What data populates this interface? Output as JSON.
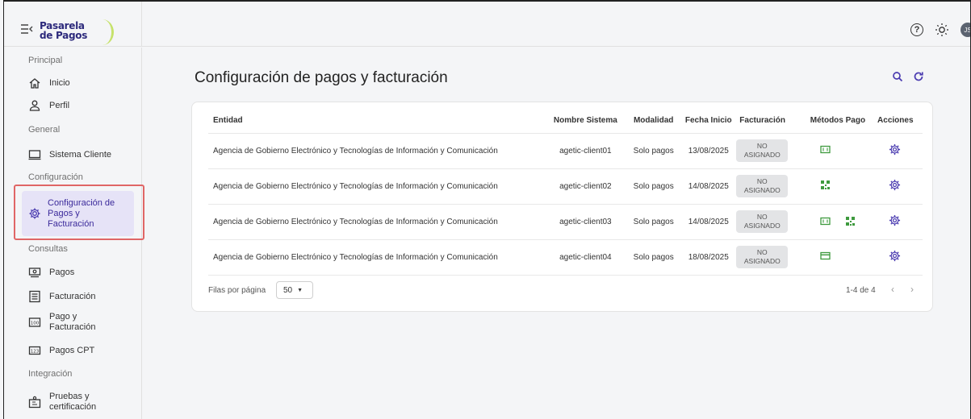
{
  "app": {
    "logo_line1": "Pasarela",
    "logo_line2": "de Pagos",
    "user_initials": "JS"
  },
  "sidebar": {
    "sections": [
      {
        "title": "Principal"
      },
      {
        "title": "General"
      },
      {
        "title": "Configuración"
      },
      {
        "title": "Consultas"
      },
      {
        "title": "Integración"
      }
    ],
    "items": [
      {
        "label": "Inicio",
        "icon": "home-icon"
      },
      {
        "label": "Perfil",
        "icon": "user-icon"
      },
      {
        "label": "Sistema Cliente",
        "icon": "monitor-icon"
      },
      {
        "label": "Configuración de Pagos y Facturación",
        "icon": "gear-icon",
        "active": true
      },
      {
        "label": "Pagos",
        "icon": "payments-icon"
      },
      {
        "label": "Facturación",
        "icon": "invoice-icon"
      },
      {
        "label_line1": "Pago y",
        "label_line2": "Facturación",
        "icon": "pay-invoice-icon"
      },
      {
        "label": "Pagos CPT",
        "icon": "cpt-icon"
      },
      {
        "label_line1": "Pruebas y",
        "label_line2": "certificación",
        "icon": "certification-icon"
      }
    ]
  },
  "main": {
    "title": "Configuración de pagos y facturación",
    "table": {
      "columns": [
        "Entidad",
        "Nombre Sistema",
        "Modalidad",
        "Fecha Inicio",
        "Facturación",
        "Métodos Pago",
        "Acciones"
      ],
      "rows": [
        {
          "entidad": "Agencia de Gobierno Electrónico y Tecnologías de Información y Comunicación",
          "sistema": "agetic-client01",
          "modalidad": "Solo pagos",
          "fecha": "13/08/2025",
          "fact_1": "NO",
          "fact_2": "ASIGNADO",
          "metodos": [
            "cash-icon"
          ]
        },
        {
          "entidad": "Agencia de Gobierno Electrónico y Tecnologías de Información y Comunicación",
          "sistema": "agetic-client02",
          "modalidad": "Solo pagos",
          "fecha": "14/08/2025",
          "fact_1": "NO",
          "fact_2": "ASIGNADO",
          "metodos": [
            "qr-icon"
          ]
        },
        {
          "entidad": "Agencia de Gobierno Electrónico y Tecnologías de Información y Comunicación",
          "sistema": "agetic-client03",
          "modalidad": "Solo pagos",
          "fecha": "14/08/2025",
          "fact_1": "NO",
          "fact_2": "ASIGNADO",
          "metodos": [
            "cash-icon",
            "qr-icon"
          ]
        },
        {
          "entidad": "Agencia de Gobierno Electrónico y Tecnologías de Información y Comunicación",
          "sistema": "agetic-client04",
          "modalidad": "Solo pagos",
          "fecha": "18/08/2025",
          "fact_1": "NO",
          "fact_2": "ASIGNADO",
          "metodos": [
            "card-icon"
          ]
        }
      ]
    },
    "pagination": {
      "rows_per_page_label": "Filas por página",
      "rows_per_page_value": "50",
      "range": "1-4 de 4"
    }
  },
  "colors": {
    "accent": "#4a3bb0",
    "method_green": "#3e9a3e",
    "active_bg": "#e6e3f7",
    "highlight": "#e06666"
  }
}
